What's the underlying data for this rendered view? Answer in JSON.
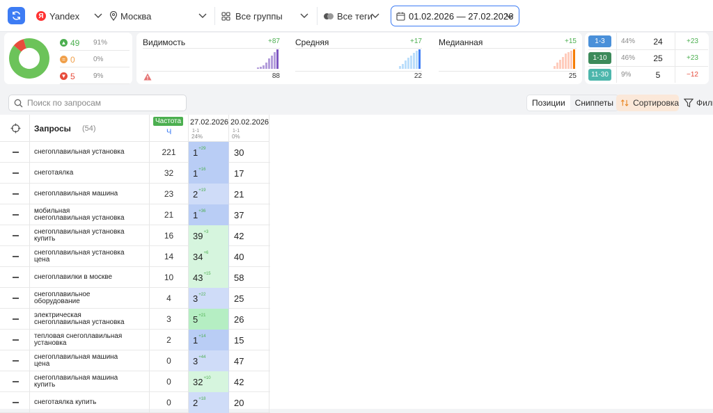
{
  "toolbar": {
    "engine": "Yandex",
    "region": "Москва",
    "groups": "Все группы",
    "tags": "Все теги",
    "date_range": "01.02.2026 — 27.02.2026"
  },
  "summary": {
    "donut": [
      {
        "label": "up",
        "value": 49,
        "color": "#6cc35a"
      },
      {
        "label": "same",
        "value": 0,
        "color": "#f0a04b"
      },
      {
        "label": "down",
        "value": 5,
        "color": "#e74c3c"
      }
    ],
    "stats": [
      {
        "value": "49",
        "pct": "91%",
        "color": "#4caf50",
        "icon": "arrow-up-icon"
      },
      {
        "value": "0",
        "pct": "0%",
        "color": "#f0a04b",
        "icon": "equal-icon"
      },
      {
        "value": "5",
        "pct": "9%",
        "color": "#e74c3c",
        "icon": "arrow-down-icon"
      }
    ]
  },
  "metrics": [
    {
      "title": "Видимость",
      "delta": "+87",
      "value": "88",
      "bars": [
        2,
        3,
        5,
        8,
        14,
        18,
        22,
        26
      ],
      "color": "#b39ddb",
      "last_color": "#7e57c2",
      "warn": true
    },
    {
      "title": "Средняя",
      "delta": "+17",
      "value": "22",
      "bars": [
        2,
        4,
        7,
        9,
        11,
        13,
        15,
        16
      ],
      "color": "#bbdefb",
      "last_color": "#3d7cf4",
      "warn": false
    },
    {
      "title": "Медианная",
      "delta": "+15",
      "value": "25",
      "bars": [
        2,
        4,
        6,
        8,
        10,
        11,
        12,
        13
      ],
      "color": "#ffccbc",
      "last_color": "#f57c00",
      "warn": false
    }
  ],
  "ranges": [
    {
      "label": "1-3",
      "pct": "44%",
      "count": "24",
      "delta": "+23",
      "color": "#4a90d9",
      "delta_color": "#4caf50"
    },
    {
      "label": "1-10",
      "pct": "46%",
      "count": "25",
      "delta": "+23",
      "color": "#3c8a5a",
      "delta_color": "#4caf50"
    },
    {
      "label": "11-30",
      "pct": "9%",
      "count": "5",
      "delta": "−12",
      "color": "#4db6ac",
      "delta_color": "#e74c3c"
    }
  ],
  "search": {
    "placeholder": "Поиск по запросам"
  },
  "view_tabs": {
    "positions": "Позиции",
    "snippets": "Сниппеты"
  },
  "sort_label": "Сортировка",
  "filter_label": "Фильтры",
  "table": {
    "queries_label": "Запросы",
    "queries_count": "(54)",
    "freq_badge": "Частота",
    "freq_sub": "Ч",
    "date1": "27.02.2026",
    "date1_sub": "1-1",
    "date1_pct": "24%",
    "date2": "20.02.2026",
    "date2_sub": "1-1",
    "date2_pct": "0%",
    "rows": [
      {
        "q1": "снегоплавильная установка",
        "q2": "",
        "freq": "221",
        "pos": "1",
        "delta": "+29",
        "prev": "30",
        "bg": "#b9cdf5"
      },
      {
        "q1": "снеготаялка",
        "q2": "",
        "freq": "32",
        "pos": "1",
        "delta": "+16",
        "prev": "17",
        "bg": "#b9cdf5"
      },
      {
        "q1": "снегоплавильная машина",
        "q2": "",
        "freq": "23",
        "pos": "2",
        "delta": "+19",
        "prev": "21",
        "bg": "#cfdcf8"
      },
      {
        "q1": "мобильная",
        "q2": "снегоплавильная установка",
        "freq": "21",
        "pos": "1",
        "delta": "+36",
        "prev": "37",
        "bg": "#b9cdf5"
      },
      {
        "q1": "снегоплавильная установка",
        "q2": "купить",
        "freq": "16",
        "pos": "39",
        "delta": "+3",
        "prev": "42",
        "bg": "#d6f5de"
      },
      {
        "q1": "снегоплавильная установка",
        "q2": "цена",
        "freq": "14",
        "pos": "34",
        "delta": "+6",
        "prev": "40",
        "bg": "#d6f5de"
      },
      {
        "q1": "снегоплавилки в москве",
        "q2": "",
        "freq": "10",
        "pos": "43",
        "delta": "+15",
        "prev": "58",
        "bg": "#d6f5de"
      },
      {
        "q1": "снегоплавильное",
        "q2": "оборудование",
        "freq": "4",
        "pos": "3",
        "delta": "+22",
        "prev": "25",
        "bg": "#cfdcf8"
      },
      {
        "q1": "электрическая",
        "q2": "снегоплавильная установка",
        "freq": "3",
        "pos": "5",
        "delta": "+21",
        "prev": "26",
        "bg": "#b5eec3"
      },
      {
        "q1": "тепловая снегоплавильная",
        "q2": "установка",
        "freq": "2",
        "pos": "1",
        "delta": "+14",
        "prev": "15",
        "bg": "#b9cdf5"
      },
      {
        "q1": "снегоплавильная машина",
        "q2": "цена",
        "freq": "0",
        "pos": "3",
        "delta": "+44",
        "prev": "47",
        "bg": "#cfdcf8"
      },
      {
        "q1": "снегоплавильная машина",
        "q2": "купить",
        "freq": "0",
        "pos": "32",
        "delta": "+10",
        "prev": "42",
        "bg": "#d6f5de"
      },
      {
        "q1": "снеготаялка купить",
        "q2": "",
        "freq": "0",
        "pos": "2",
        "delta": "+18",
        "prev": "20",
        "bg": "#cfdcf8"
      }
    ]
  }
}
